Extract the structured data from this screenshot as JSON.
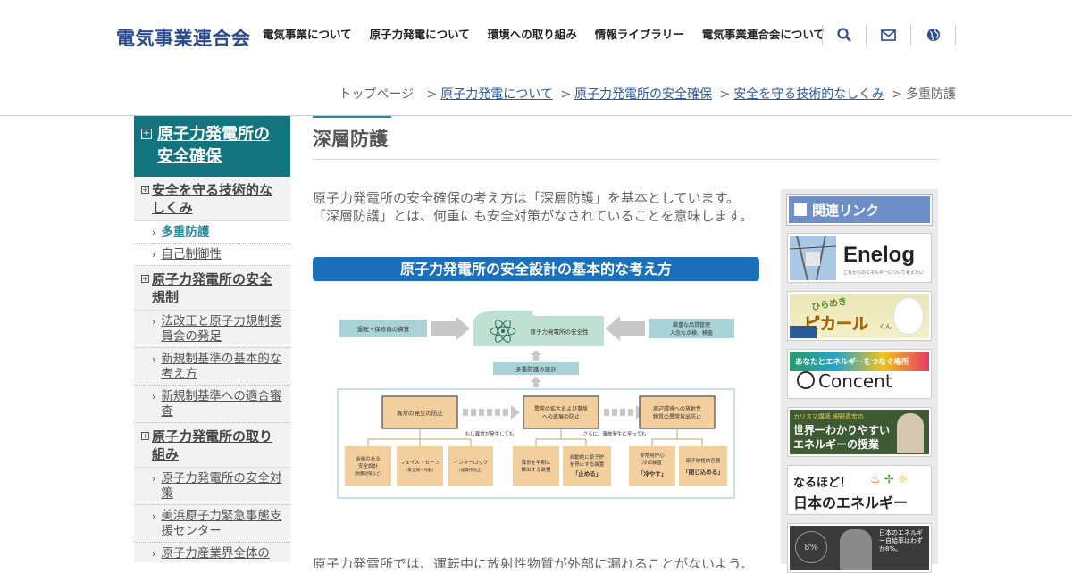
{
  "header": {
    "logo": "電気事業連合会",
    "nav": [
      "電気事業について",
      "原子力発電について",
      "環境への取り組み",
      "情報ライブラリー",
      "電気事業連合会について"
    ],
    "tools": [
      "search-icon",
      "mail-icon",
      "globe-icon"
    ]
  },
  "breadcrumb": {
    "home": "トップページ",
    "links": [
      "原子力発電について",
      "原子力発電所の安全確保",
      "安全を守る技術的なしくみ"
    ],
    "current": "多重防護",
    "separator": ">"
  },
  "sidebar": {
    "head": "原子力発電所の安全確保",
    "sections": [
      {
        "label": "安全を守る技術的なしくみ",
        "items": [
          "多重防護",
          "自己制御性"
        ]
      },
      {
        "label": "原子力発電所の安全規制",
        "items": [
          "法改正と原子力規制委員会の発足",
          "新規制基準の基本的な考え方",
          "新規制基準への適合審査"
        ]
      },
      {
        "label": "原子力発電所の取り組み",
        "items": [
          "原子力発電所の安全対策",
          "美浜原子力緊急事態支援センター",
          "原子力産業界全体の"
        ]
      }
    ],
    "current": "多重防護"
  },
  "main": {
    "title": "深層防護",
    "intro": "原子力発電所の安全確保の考え方は「深層防護」を基本としています。「深層防護」とは、何重にも安全対策がなされていることを意味します。",
    "heading": "原子力発電所の安全設計の基本的な考え方",
    "bottom_text": "原子力発電所では、運転中に放射性物質が外部に漏れることがないよう、"
  },
  "diagram": {
    "left_top": "運転・保修員の資質",
    "center_top": "原子力発電所の安全性",
    "right_top": "厳重な品質管理\n入念な点検、検査",
    "mid": "多重防護の設計",
    "steps": [
      "異常の発生の防止",
      "異常の拡大および事故\nへの進展の防止",
      "周辺環境への放射性\n物質の異常放出防止"
    ],
    "notes": [
      "もし異常が発生しても",
      "さらに、事故発生に至っても"
    ],
    "boxes": [
      "余裕のある\n安全設計\n（地震対策など）",
      "フェイル・セーフ\n（安全側へ作動）",
      "インターロック\n（誤操作防止）",
      "異常を早期に\n検出する装置",
      "自動的に原子炉\nを停止する装置\n「止める」",
      "非常用炉心\n冷却装置\n「冷やす」",
      "原子炉格納容器\n「閉じ込める」"
    ]
  },
  "related": {
    "head": "関連リンク",
    "banners": [
      {
        "title": "Enelog",
        "sub": "これからのエネルギーについて考えたい"
      },
      {
        "title": "ピカール",
        "sub": "ひらめき",
        "suffix": "くん"
      },
      {
        "title": "Concent",
        "sub": "あなたとエネルギーをつなぐ場所"
      },
      {
        "title": "エネルギーの授業",
        "sub": "世界一わかりやすい",
        "top": "カリスマ講師 細野真宏の"
      },
      {
        "title": "日本のエネルギー",
        "sub": "なるほど！"
      },
      {
        "title": "日本のエネルギー自給率はわずか8%。",
        "sub": "8%"
      }
    ]
  },
  "colors": {
    "brand": "#2b4a8f",
    "teal": "#137480",
    "heading_blue": "#1c6fbb",
    "related_blue": "#6f8fc9"
  }
}
